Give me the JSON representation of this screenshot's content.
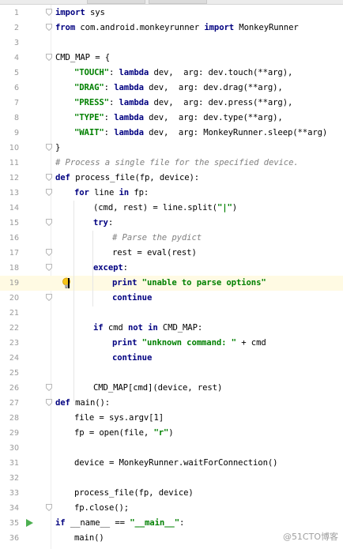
{
  "lines": [
    {
      "n": "1",
      "indent": 0,
      "tokens": [
        {
          "t": "import",
          "c": "kw"
        },
        {
          "t": " sys"
        }
      ]
    },
    {
      "n": "2",
      "indent": 0,
      "tokens": [
        {
          "t": "from",
          "c": "kw"
        },
        {
          "t": " com.android.monkeyrunner "
        },
        {
          "t": "import",
          "c": "kw"
        },
        {
          "t": " MonkeyRunner"
        }
      ]
    },
    {
      "n": "3",
      "indent": 0,
      "tokens": []
    },
    {
      "n": "4",
      "indent": 0,
      "tokens": [
        {
          "t": "CMD_MAP = {"
        }
      ]
    },
    {
      "n": "5",
      "indent": 1,
      "tokens": [
        {
          "t": "\"TOUCH\"",
          "c": "str"
        },
        {
          "t": ": "
        },
        {
          "t": "lambda",
          "c": "kw"
        },
        {
          "t": " dev,  arg: dev.touch(**arg),"
        }
      ]
    },
    {
      "n": "6",
      "indent": 1,
      "tokens": [
        {
          "t": "\"DRAG\"",
          "c": "str"
        },
        {
          "t": ": "
        },
        {
          "t": "lambda",
          "c": "kw"
        },
        {
          "t": " dev,  arg: dev.drag(**arg),"
        }
      ]
    },
    {
      "n": "7",
      "indent": 1,
      "tokens": [
        {
          "t": "\"PRESS\"",
          "c": "str"
        },
        {
          "t": ": "
        },
        {
          "t": "lambda",
          "c": "kw"
        },
        {
          "t": " dev,  arg: dev.press(**arg),"
        }
      ]
    },
    {
      "n": "8",
      "indent": 1,
      "tokens": [
        {
          "t": "\"TYPE\"",
          "c": "str"
        },
        {
          "t": ": "
        },
        {
          "t": "lambda",
          "c": "kw"
        },
        {
          "t": " dev,  arg: dev.type(**arg),"
        }
      ]
    },
    {
      "n": "9",
      "indent": 1,
      "tokens": [
        {
          "t": "\"WAIT\"",
          "c": "str"
        },
        {
          "t": ": "
        },
        {
          "t": "lambda",
          "c": "kw"
        },
        {
          "t": " dev,  arg: MonkeyRunner.sleep(**arg)"
        }
      ]
    },
    {
      "n": "10",
      "indent": 0,
      "tokens": [
        {
          "t": "}"
        }
      ]
    },
    {
      "n": "11",
      "indent": 0,
      "tokens": [
        {
          "t": "# Process a single file for the specified device.",
          "c": "cm"
        }
      ]
    },
    {
      "n": "12",
      "indent": 0,
      "tokens": [
        {
          "t": "def",
          "c": "kw"
        },
        {
          "t": " process_file(fp, device):"
        }
      ]
    },
    {
      "n": "13",
      "indent": 1,
      "tokens": [
        {
          "t": "for",
          "c": "kw"
        },
        {
          "t": " line "
        },
        {
          "t": "in",
          "c": "kw"
        },
        {
          "t": " fp:"
        }
      ]
    },
    {
      "n": "14",
      "indent": 2,
      "tokens": [
        {
          "t": "(cmd, rest) = line.split("
        },
        {
          "t": "\"|\"",
          "c": "str"
        },
        {
          "t": ")"
        }
      ]
    },
    {
      "n": "15",
      "indent": 2,
      "tokens": [
        {
          "t": "try",
          "c": "kw"
        },
        {
          "t": ":"
        }
      ]
    },
    {
      "n": "16",
      "indent": 3,
      "tokens": [
        {
          "t": "# Parse the pydict",
          "c": "cm"
        }
      ]
    },
    {
      "n": "17",
      "indent": 3,
      "tokens": [
        {
          "t": "rest = eval(rest)"
        }
      ]
    },
    {
      "n": "18",
      "indent": 2,
      "tokens": [
        {
          "t": "except",
          "c": "kw"
        },
        {
          "t": ":"
        }
      ]
    },
    {
      "n": "19",
      "indent": 3,
      "tokens": [
        {
          "t": "print",
          "c": "kw"
        },
        {
          "t": " "
        },
        {
          "t": "\"unable to parse options\"",
          "c": "str"
        }
      ]
    },
    {
      "n": "20",
      "indent": 3,
      "tokens": [
        {
          "t": "continue",
          "c": "kw"
        }
      ]
    },
    {
      "n": "21",
      "indent": 0,
      "tokens": []
    },
    {
      "n": "22",
      "indent": 2,
      "tokens": [
        {
          "t": "if",
          "c": "kw"
        },
        {
          "t": " cmd "
        },
        {
          "t": "not",
          "c": "kw"
        },
        {
          "t": " "
        },
        {
          "t": "in",
          "c": "kw"
        },
        {
          "t": " CMD_MAP:"
        }
      ]
    },
    {
      "n": "23",
      "indent": 3,
      "tokens": [
        {
          "t": "print",
          "c": "kw"
        },
        {
          "t": " "
        },
        {
          "t": "\"unknown command: \"",
          "c": "str"
        },
        {
          "t": " + cmd"
        }
      ]
    },
    {
      "n": "24",
      "indent": 3,
      "tokens": [
        {
          "t": "continue",
          "c": "kw"
        }
      ]
    },
    {
      "n": "25",
      "indent": 0,
      "tokens": []
    },
    {
      "n": "26",
      "indent": 2,
      "tokens": [
        {
          "t": "CMD_MAP[cmd](device, rest)"
        }
      ]
    },
    {
      "n": "27",
      "indent": 0,
      "tokens": [
        {
          "t": "def",
          "c": "kw"
        },
        {
          "t": " main():"
        }
      ]
    },
    {
      "n": "28",
      "indent": 1,
      "tokens": [
        {
          "t": "file = sys.argv[1]"
        }
      ]
    },
    {
      "n": "29",
      "indent": 1,
      "tokens": [
        {
          "t": "fp = open(file, "
        },
        {
          "t": "\"r\"",
          "c": "str"
        },
        {
          "t": ")"
        }
      ]
    },
    {
      "n": "30",
      "indent": 0,
      "tokens": []
    },
    {
      "n": "31",
      "indent": 1,
      "tokens": [
        {
          "t": "device = MonkeyRunner.waitForConnection()"
        }
      ]
    },
    {
      "n": "32",
      "indent": 0,
      "tokens": []
    },
    {
      "n": "33",
      "indent": 1,
      "tokens": [
        {
          "t": "process_file(fp, device)"
        }
      ]
    },
    {
      "n": "34",
      "indent": 1,
      "tokens": [
        {
          "t": "fp.close();"
        }
      ]
    },
    {
      "n": "35",
      "indent": 0,
      "tokens": [
        {
          "t": "if",
          "c": "kw"
        },
        {
          "t": " __name__ == "
        },
        {
          "t": "\"__main__\"",
          "c": "str"
        },
        {
          "t": ":"
        }
      ]
    },
    {
      "n": "36",
      "indent": 1,
      "tokens": [
        {
          "t": "main()"
        }
      ]
    }
  ],
  "current_line": "19",
  "fold_lines": [
    "1",
    "2",
    "4",
    "10",
    "12",
    "13",
    "15",
    "17",
    "18",
    "20",
    "26",
    "27",
    "34"
  ],
  "run_line": "35",
  "intention_icon": "lightbulb-icon",
  "watermark": "@51CTO博客",
  "colors": {
    "keyword": "#000080",
    "string": "#008000",
    "comment": "#808080",
    "current_line_bg": "#fffae3",
    "line_number": "#999999"
  }
}
